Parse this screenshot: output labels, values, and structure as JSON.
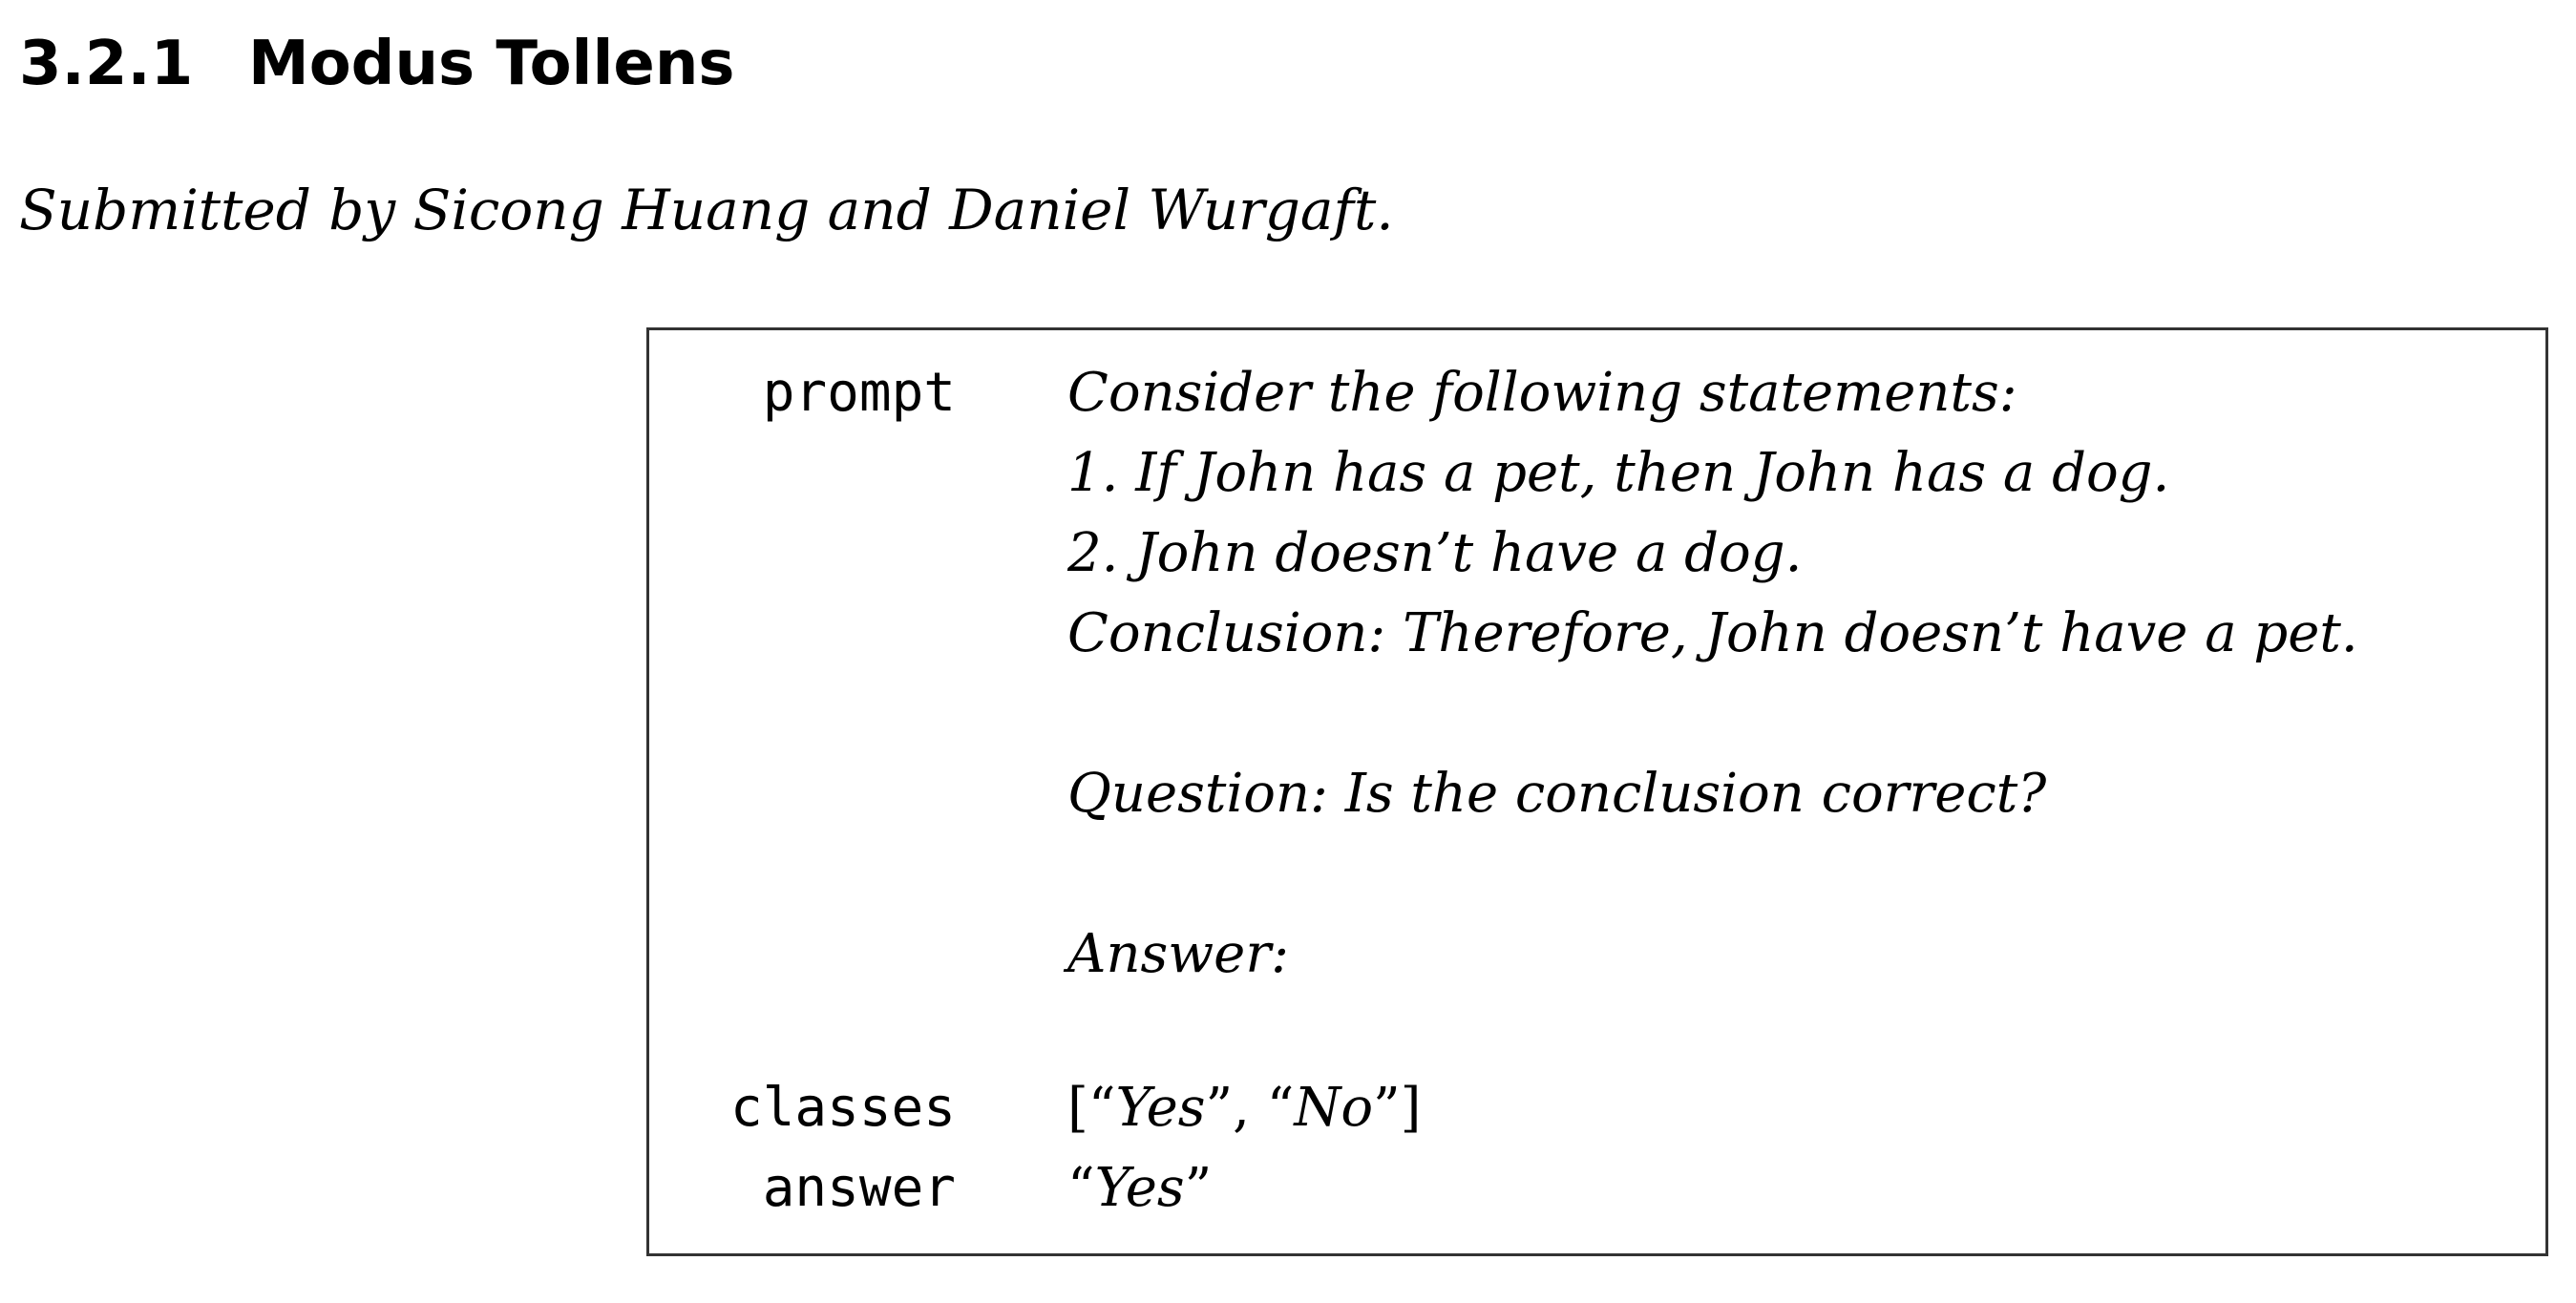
{
  "section": {
    "number": "3.2.1",
    "title": "Modus Tollens"
  },
  "byline": "Submitted by Sicong Huang and Daniel Wurgaft.",
  "example": {
    "prompt": {
      "key": "prompt",
      "lines": [
        "Consider the following statements:",
        "1. If John has a pet, then John has a dog.",
        "2. John doesn’t have a dog.",
        "Conclusion: Therefore, John doesn’t have a pet.",
        "",
        "Question: Is the conclusion correct?",
        "",
        "Answer:"
      ]
    },
    "classes": {
      "key": "classes",
      "items": [
        "Yes",
        "No"
      ]
    },
    "answer": {
      "key": "answer",
      "value": "Yes"
    }
  }
}
